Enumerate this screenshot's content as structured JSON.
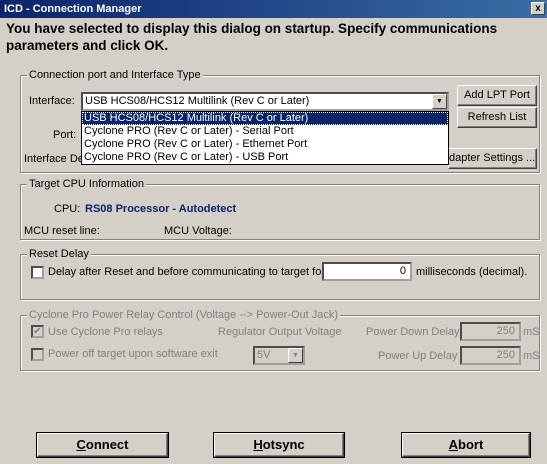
{
  "window": {
    "title": "ICD - Connection Manager",
    "close_glyph": "x"
  },
  "headline": "You have selected to display this dialog on startup. Specify communications parameters and click OK.",
  "connection": {
    "legend": "Connection port and Interface Type",
    "interface_label": "Interface:",
    "interface_value": "USB HCS08/HCS12 Multilink (Rev C or Later)",
    "port_label": "Port:",
    "interface_detail_label": "Interface De",
    "add_lpt_label": "Add LPT Port",
    "refresh_label": "Refresh List",
    "adapter_settings_label": "dapter Settings ...",
    "dropdown_options": [
      "USB HCS08/HCS12 Multilink (Rev C or Later)",
      "Cyclone PRO (Rev C or Later) - Serial Port",
      "Cyclone PRO (Rev C or Later) - Ethernet Port",
      "Cyclone PRO (Rev C or Later) - USB Port"
    ],
    "selected_index": 0
  },
  "target_cpu": {
    "legend": "Target CPU Information",
    "cpu_label": "CPU:",
    "cpu_value": "RS08 Processor - Autodetect",
    "reset_line_label": "MCU reset line:",
    "voltage_label": "MCU Voltage:"
  },
  "reset_delay": {
    "legend": "Reset Delay",
    "checkbox_label": "Delay after Reset and before communicating to target for",
    "checked": false,
    "value": "0",
    "unit_label": "milliseconds (decimal)."
  },
  "power": {
    "legend": "Cyclone Pro Power Relay Control  (Voltage --> Power-Out Jack)",
    "use_relays_label": "Use Cyclone Pro relays",
    "use_relays_checked": true,
    "power_off_label": "Power off target upon software exit",
    "power_off_checked": false,
    "regulator_label": "Regulator Output Voltage",
    "voltage_value": "5V",
    "power_down_label": "Power Down Delay",
    "power_down_value": "250",
    "power_up_label": "Power Up Delay",
    "power_up_value": "250",
    "ms_unit": "mS"
  },
  "buttons": {
    "connect_first": "C",
    "connect_rest": "onnect",
    "hotsync_first": "H",
    "hotsync_rest": "otsync",
    "abort_first": "A",
    "abort_rest": "bort"
  },
  "icons": {
    "close": "close-icon",
    "dropdown_arrow": "chevron-down-icon",
    "check": "checkmark-icon"
  },
  "colors": {
    "titlebar": "#0a246a",
    "selection": "#0a246a",
    "cpu_value": "#0a246a",
    "dialog_bg": "#d4d0c8"
  }
}
